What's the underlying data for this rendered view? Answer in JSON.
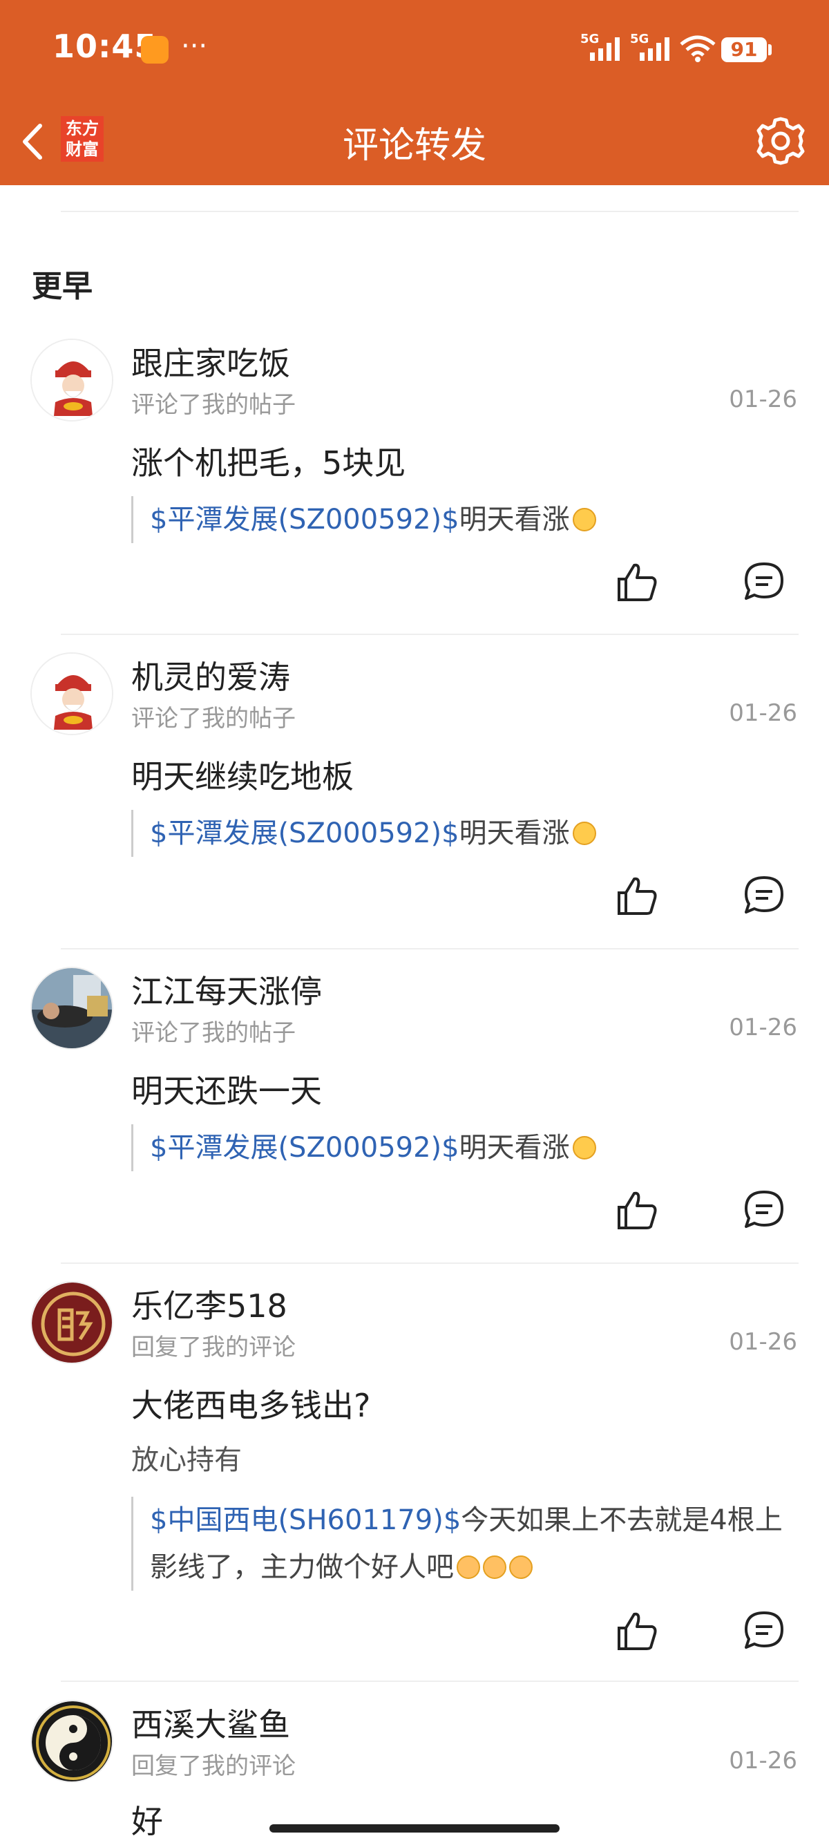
{
  "status_bar": {
    "time": "10:45",
    "more": "···",
    "signal_1": "5G",
    "signal_2": "5G",
    "battery": "91"
  },
  "nav": {
    "logo_line1": "东方",
    "logo_line2": "财富",
    "title": "评论转发"
  },
  "section_title": "更早",
  "items": [
    {
      "username": "跟庄家吃饭",
      "action": "评论了我的帖子",
      "date": "01-26",
      "comment": "涨个机把毛，5块见",
      "quote_tag": "$平潭发展(SZ000592)$",
      "quote_text": "明天看涨"
    },
    {
      "username": "机灵的爱涛",
      "action": "评论了我的帖子",
      "date": "01-26",
      "comment": "明天继续吃地板",
      "quote_tag": "$平潭发展(SZ000592)$",
      "quote_text": "明天看涨"
    },
    {
      "username": "江江每天涨停",
      "action": "评论了我的帖子",
      "date": "01-26",
      "comment": "明天还跌一天",
      "quote_tag": "$平潭发展(SZ000592)$",
      "quote_text": "明天看涨"
    },
    {
      "username": "乐亿李518",
      "action": "回复了我的评论",
      "date": "01-26",
      "comment": "大佬西电多钱出?",
      "reply": "放心持有",
      "quote_tag": "$中国西电(SH601179)$",
      "quote_text": "今天如果上不去就是4根上影线了，主力做个好人吧"
    },
    {
      "username": "西溪大鲨鱼",
      "action": "回复了我的评论",
      "date": "01-26",
      "comment": "好"
    }
  ],
  "colors": {
    "header": "#db5d26",
    "link": "#2f63b3",
    "muted": "#999999"
  }
}
